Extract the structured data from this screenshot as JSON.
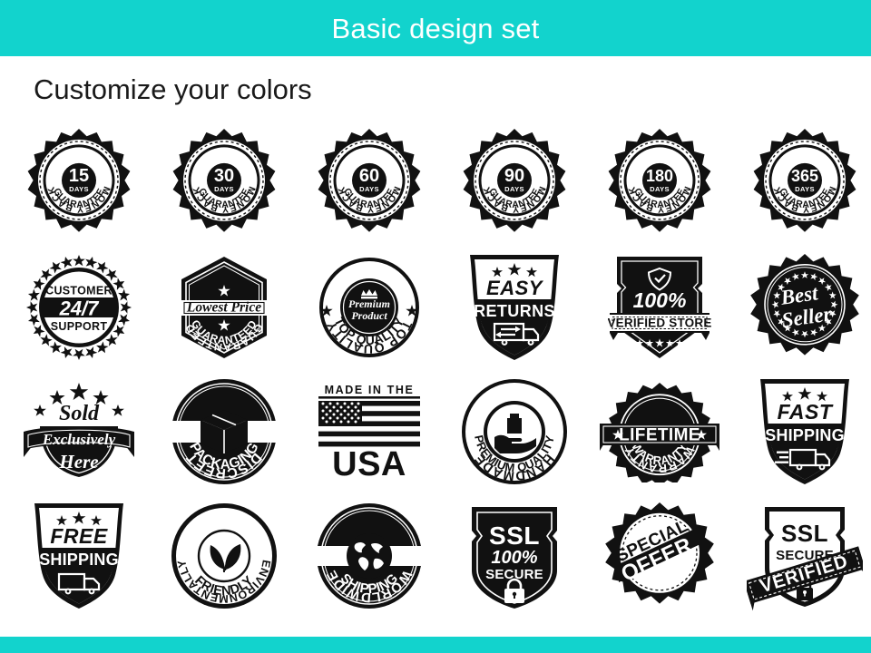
{
  "header": {
    "title": "Basic design set",
    "bar_color": "#12d3cd"
  },
  "footer": {
    "bar_color": "#12d3cd"
  },
  "subtitle": "Customize your colors",
  "palette": {
    "ink": "#111111",
    "paper": "#ffffff",
    "accent": "#12d3cd"
  },
  "badges": [
    [
      {
        "name": "money-back-guarantee-15",
        "shape": "starburst-seal",
        "icon": "none",
        "top_arc": "MONEY BACK",
        "bottom_arc": "GUARANTEE",
        "center_primary": "15",
        "center_secondary": "DAYS"
      },
      {
        "name": "money-back-guarantee-30",
        "shape": "starburst-seal",
        "icon": "none",
        "top_arc": "MONEY BACK",
        "bottom_arc": "GUARANTEE",
        "center_primary": "30",
        "center_secondary": "DAYS"
      },
      {
        "name": "money-back-guarantee-60",
        "shape": "starburst-seal",
        "icon": "none",
        "top_arc": "MONEY BACK",
        "bottom_arc": "GUARANTEE",
        "center_primary": "60",
        "center_secondary": "DAYS"
      },
      {
        "name": "money-back-guarantee-90",
        "shape": "starburst-seal",
        "icon": "none",
        "top_arc": "MONEY BACK",
        "bottom_arc": "GUARANTEE",
        "center_primary": "90",
        "center_secondary": "DAYS"
      },
      {
        "name": "money-back-guarantee-180",
        "shape": "starburst-seal",
        "icon": "none",
        "top_arc": "MONEY BACK",
        "bottom_arc": "GUARANTEE",
        "center_primary": "180",
        "center_secondary": "DAYS"
      },
      {
        "name": "money-back-guarantee-365",
        "shape": "starburst-seal",
        "icon": "none",
        "top_arc": "MONEY BACK",
        "bottom_arc": "GUARANTEE",
        "center_primary": "365",
        "center_secondary": "DAYS"
      }
    ],
    [
      {
        "name": "customer-24-7-support",
        "shape": "star-ring-circle",
        "icon": "none",
        "line1": "CUSTOMER",
        "line2": "24/7",
        "line3": "SUPPORT"
      },
      {
        "name": "lowest-price-guaranteed",
        "shape": "hexagon",
        "icon": "star",
        "top_arc": "GUARANTEED",
        "banner": "Lowest Price",
        "bottom_arc": "GUARANTEED"
      },
      {
        "name": "top-quality-premium-product",
        "shape": "circle-ring",
        "icon": "crown-icon",
        "top_arc": "TOP QUALITY",
        "bottom_arc": "TOP QUALITY",
        "center_line1": "Premium",
        "center_line2": "Product"
      },
      {
        "name": "easy-returns",
        "shape": "shield",
        "icon": "return-truck-icon",
        "stars": "★ ★ ★",
        "line1": "EASY",
        "line2": "RETURNS"
      },
      {
        "name": "verified-store-100",
        "shape": "shield-banner",
        "icon": "shield-check-icon",
        "line1": "100%",
        "banner": "VERIFIED STORE",
        "stars": "★ ★ ★ ★ ★"
      },
      {
        "name": "best-seller",
        "shape": "starburst-seal",
        "icon": "none",
        "line1": "Best",
        "line2": "Seller"
      }
    ],
    [
      {
        "name": "sold-exclusively-here",
        "shape": "crest-ribbon",
        "icon": "stars-arc",
        "line1": "Sold",
        "banner": "Exclusively",
        "line3": "Here"
      },
      {
        "name": "discreet-packaging",
        "shape": "circle-band",
        "icon": "box-icon",
        "top_arc": "DISCREET",
        "bottom_arc": "PACKAGING"
      },
      {
        "name": "made-in-the-usa",
        "shape": "flag-block",
        "icon": "us-flag-icon",
        "line1": "MADE IN THE",
        "line2": "USA"
      },
      {
        "name": "handmade-premium-quality",
        "shape": "circle-ring",
        "icon": "hand-holding-product-icon",
        "top_arc": "HANDMADE",
        "bottom_arc": "PREMIUM QUALITY"
      },
      {
        "name": "lifetime-warranty",
        "shape": "starburst-ribbon",
        "icon": "star",
        "top_arc": "WARRANTY",
        "banner": "LIFETIME",
        "bottom_arc": "WARRANTY"
      },
      {
        "name": "fast-shipping",
        "shape": "shield",
        "icon": "truck-icon",
        "stars": "★ ★ ★",
        "line1": "FAST",
        "line2": "SHIPPING"
      }
    ],
    [
      {
        "name": "free-shipping",
        "shape": "shield",
        "icon": "truck-icon",
        "stars": "★ ★ ★",
        "line1": "FREE",
        "line2": "SHIPPING"
      },
      {
        "name": "environmentally-friendly",
        "shape": "circle-ring",
        "icon": "leaf-icon",
        "top_arc": "ENVIRONMENTALLY",
        "bottom_arc": "FRIENDLY"
      },
      {
        "name": "worldwide-shipping",
        "shape": "circle-band",
        "icon": "globe-icon",
        "top_arc": "WORLDWIDE",
        "bottom_arc": "SHIPPING"
      },
      {
        "name": "ssl-100-secure",
        "shape": "shield",
        "icon": "padlock-icon",
        "line1": "SSL",
        "line2": "100%",
        "line3": "SECURE"
      },
      {
        "name": "special-offer",
        "shape": "starburst-seal",
        "icon": "none",
        "line1": "SPECIAL",
        "line2": "OFFER"
      },
      {
        "name": "ssl-secure-verified",
        "shape": "shield-ribbon",
        "icon": "padlock-icon",
        "line1": "SSL",
        "line2": "SECURE",
        "banner": "VERIFIED"
      }
    ]
  ]
}
